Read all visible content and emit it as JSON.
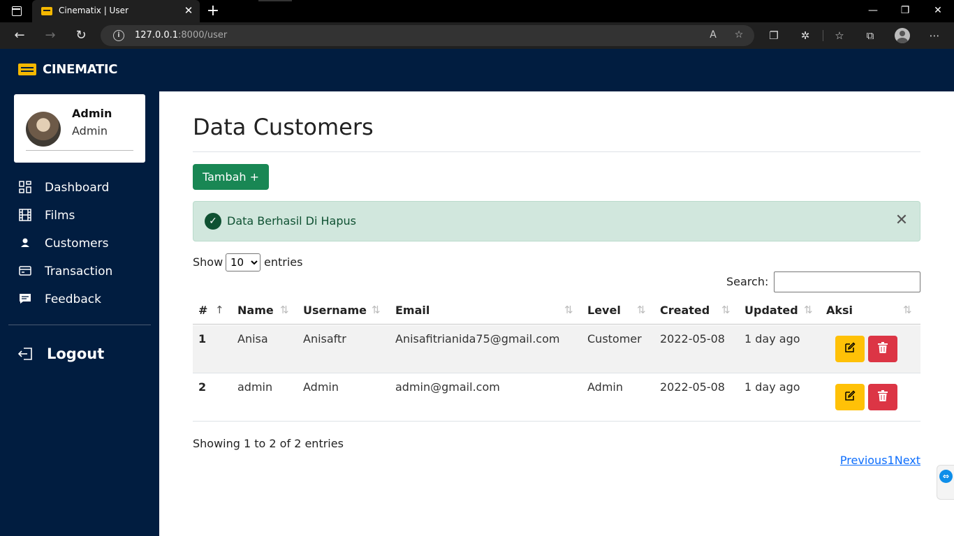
{
  "browser": {
    "tab_title": "Cinematix | User",
    "tab_close": "✕",
    "new_tab": "+",
    "url_host": "127.0.0.1",
    "url_path": ":8000/user",
    "window_controls": [
      "—",
      "❐",
      "✕"
    ],
    "icons": [
      "read-aloud-icon",
      "favorite-add-icon",
      "tab-actions-icon",
      "extensions-icon",
      "favorites-icon",
      "collections-icon",
      "profile-icon",
      "more-icon"
    ]
  },
  "app": {
    "logo_text": "CINEMATIC",
    "brand_color": "#011d40",
    "accent_color": "#f5b800"
  },
  "user": {
    "name": "Admin",
    "role": "Admin"
  },
  "sidebar": {
    "items": [
      {
        "label": "Dashboard",
        "icon": "dashboard-icon"
      },
      {
        "label": "Films",
        "icon": "film-icon"
      },
      {
        "label": "Customers",
        "icon": "user-icon"
      },
      {
        "label": "Transaction",
        "icon": "credit-card-icon"
      },
      {
        "label": "Feedback",
        "icon": "chat-icon"
      }
    ],
    "logout_label": "Logout"
  },
  "main": {
    "title": "Data Customers",
    "add_button": "Tambah +",
    "alert_text": "Data Berhasil Di Hapus",
    "show_label": "Show",
    "entries_value": "10",
    "entries_label": "entries",
    "search_label": "Search:",
    "search_value": "",
    "columns": [
      "#",
      "Name",
      "Username",
      "Email",
      "Level",
      "Created",
      "Updated",
      "Aksi"
    ],
    "rows": [
      {
        "no": "1",
        "name": "Anisa",
        "username": "Anisaftr",
        "email": "Anisafitrianida75@gmail.com",
        "level": "Customer",
        "created": "2022-05-08",
        "updated": "1 day ago"
      },
      {
        "no": "2",
        "name": "admin",
        "username": "Admin",
        "email": "admin@gmail.com",
        "level": "Admin",
        "created": "2022-05-08",
        "updated": "1 day ago"
      }
    ],
    "showing_info": "Showing 1 to 2 of 2 entries",
    "pagination": {
      "previous": "Previous",
      "page": "1",
      "next": "Next"
    }
  },
  "colors": {
    "success": "#198754",
    "alert_bg": "#d1e7dd",
    "edit": "#ffc107",
    "delete": "#dc3545",
    "link": "#0d6efd"
  }
}
